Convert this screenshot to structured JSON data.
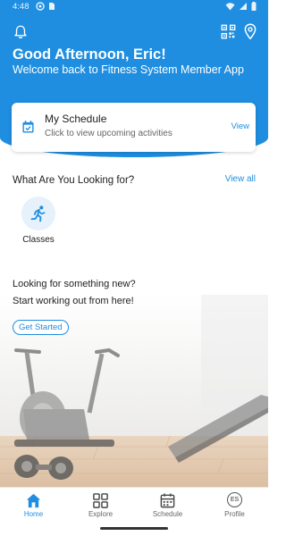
{
  "status_bar": {
    "time": "4:48"
  },
  "header": {
    "greeting": "Good Afternoon, Eric!",
    "welcome": "Welcome back to Fitness System Member App",
    "icons": [
      "bell-icon",
      "qr-code-icon",
      "location-pin-icon"
    ]
  },
  "schedule_card": {
    "title": "My Schedule",
    "subtitle": "Click to view upcoming activities",
    "view_label": "View"
  },
  "looking_for": {
    "title": "What Are You Looking for?",
    "view_all_label": "View all",
    "items": [
      {
        "label": "Classes",
        "icon": "running-person-icon"
      }
    ]
  },
  "promo": {
    "line1": "Looking for something new?",
    "line2": "Start working out from here!",
    "button_label": "Get Started"
  },
  "bottom_nav": {
    "items": [
      {
        "label": "Home",
        "icon": "home-icon",
        "active": true
      },
      {
        "label": "Explore",
        "icon": "grid-icon",
        "active": false
      },
      {
        "label": "Schedule",
        "icon": "calendar-icon",
        "active": false
      },
      {
        "label": "Profile",
        "avatar_initials": "ES",
        "active": false
      }
    ]
  },
  "colors": {
    "primary": "#1f8ee0",
    "header_bg": "#1f8ee0",
    "text": "#222222",
    "muted": "#666666"
  }
}
